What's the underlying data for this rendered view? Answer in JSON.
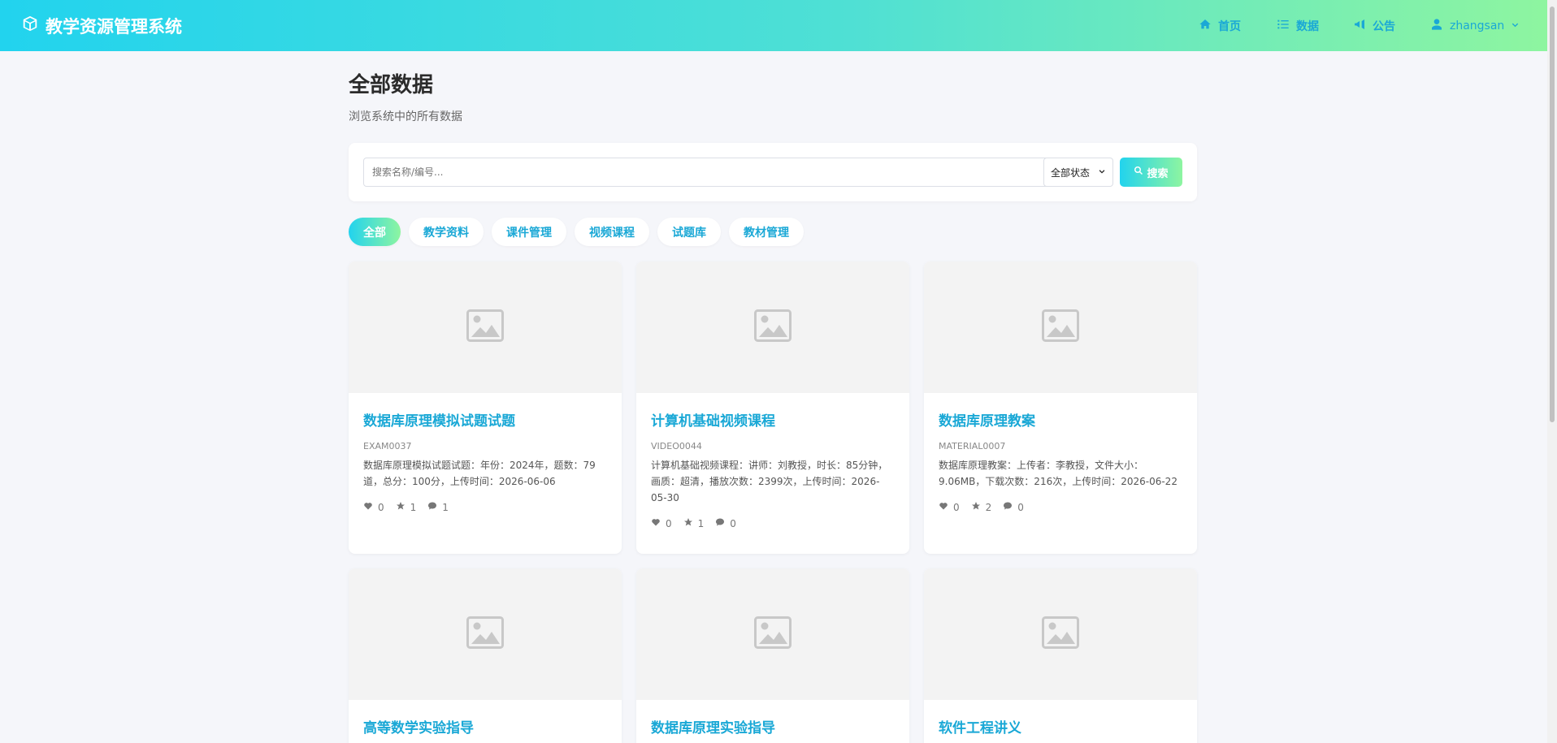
{
  "brand": {
    "title": "教学资源管理系统",
    "icon": "cube-icon"
  },
  "nav": {
    "home": "首页",
    "data": "数据",
    "notice": "公告",
    "user": "zhangsan"
  },
  "page": {
    "title": "全部数据",
    "subtitle": "浏览系统中的所有数据"
  },
  "search": {
    "placeholder": "搜索名称/编号...",
    "status_selected": "全部状态",
    "button_label": "搜索"
  },
  "categories": [
    "全部",
    "教学资料",
    "课件管理",
    "视频课程",
    "试题库",
    "教材管理"
  ],
  "cards": [
    {
      "title": "数据库原理模拟试题试题",
      "code": "EXAM0037",
      "desc": "数据库原理模拟试题试题：年份：2024年，题数：79道，总分：100分，上传时间：2026-06-06",
      "likes": "0",
      "stars": "1",
      "comments": "1"
    },
    {
      "title": "计算机基础视频课程",
      "code": "VIDEO0044",
      "desc": "计算机基础视频课程：讲师：刘教授，时长：85分钟，画质：超清，播放次数：2399次，上传时间：2026-05-30",
      "likes": "0",
      "stars": "1",
      "comments": "0"
    },
    {
      "title": "数据库原理教案",
      "code": "MATERIAL0007",
      "desc": "数据库原理教案：上传者：李教授，文件大小：9.06MB，下载次数：216次，上传时间：2026-06-22",
      "likes": "0",
      "stars": "2",
      "comments": "0"
    },
    {
      "title": "高等数学实验指导"
    },
    {
      "title": "数据库原理实验指导"
    },
    {
      "title": "软件工程讲义"
    }
  ],
  "colors": {
    "accent": "#1aa8d6",
    "gradient_start": "#22d3ee",
    "gradient_end": "#8ef5a0"
  }
}
